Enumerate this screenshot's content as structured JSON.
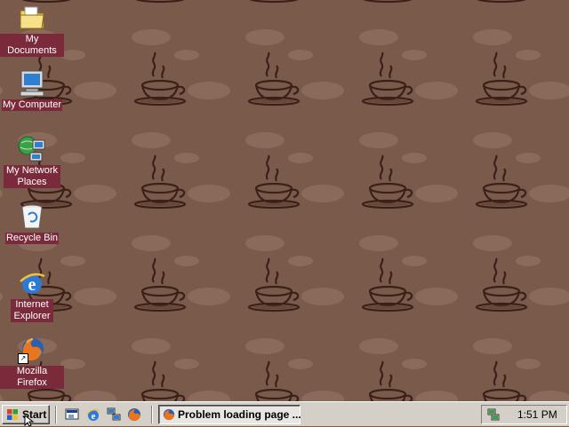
{
  "desktop": {
    "icons": [
      {
        "label": "My Documents",
        "icon": "folder-documents-icon"
      },
      {
        "label": "My Computer",
        "icon": "computer-icon"
      },
      {
        "label": "My Network Places",
        "icon": "network-icon"
      },
      {
        "label": "Recycle Bin",
        "icon": "recycle-bin-icon"
      },
      {
        "label": "Internet Explorer",
        "icon": "ie-icon"
      },
      {
        "label": "Mozilla Firefox",
        "icon": "firefox-icon"
      }
    ]
  },
  "taskbar": {
    "start_label": "Start",
    "quick_launch": [
      "show-desktop-icon",
      "ie-icon",
      "network-icon",
      "firefox-icon"
    ],
    "task_button_label": "Problem loading page ...",
    "clock": "1:51 PM"
  },
  "colors": {
    "label_bg": "#7a2a3a",
    "taskbar": "#d4d0c8",
    "wallpaper": "#7a5a4a"
  }
}
